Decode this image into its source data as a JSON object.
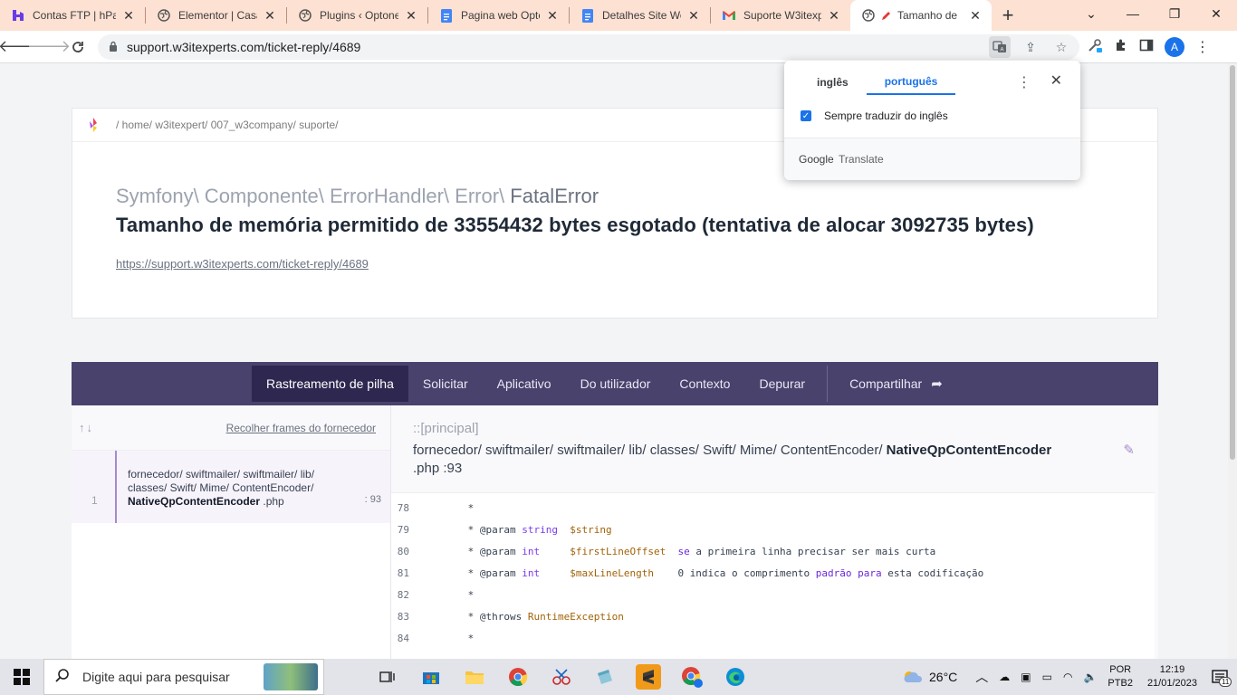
{
  "tabs": [
    {
      "title": "Contas FTP | hPan",
      "icon": "hpanel-icon"
    },
    {
      "title": "Elementor | Casa",
      "icon": "globe-icon"
    },
    {
      "title": "Plugins ‹ Optone",
      "icon": "globe-icon"
    },
    {
      "title": "Pagina web Optc",
      "icon": "docs-icon"
    },
    {
      "title": "Detalhes Site We",
      "icon": "docs-icon"
    },
    {
      "title": "Suporte W3itexp",
      "icon": "gmail-icon"
    },
    {
      "title": "Tamanho de",
      "icon": "globe-icon",
      "active": true
    }
  ],
  "address": {
    "url": "support.w3itexperts.com/ticket-reply/4689"
  },
  "profile": {
    "initial": "A"
  },
  "page": {
    "breadcrumb": "/ home/ w3itexpert/ 007_w3company/ suporte/",
    "error_class_prefix": "Symfony\\ Componente\\ ErrorHandler\\ Error\\ ",
    "error_class_name": "FatalError",
    "error_message": "Tamanho de memória permitido de 33554432 bytes esgotado (tentativa de alocar 3092735 bytes)",
    "error_url": "https://support.w3itexperts.com/ticket-reply/4689"
  },
  "stack_tabs": {
    "trace": "Rastreamento de pilha",
    "request": "Solicitar",
    "app": "Aplicativo",
    "user": "Do utilizador",
    "context": "Contexto",
    "debug": "Depurar",
    "share": "Compartilhar"
  },
  "frames": {
    "arrows": "↑↓",
    "collapse": "Recolher frames do fornecedor",
    "item": {
      "number": "1",
      "path": "fornecedor/ swiftmailer/ swiftmailer/ lib/ classes/ Swift/ Mime/ ContentEncoder/",
      "file": "NativeQpContentEncoder",
      "ext": ".php",
      "line": ": 93"
    }
  },
  "detail": {
    "main_label": "::[principal]",
    "path": "fornecedor/ swiftmailer/ swiftmailer/ lib/ classes/ Swift/ Mime/ ContentEncoder/ ",
    "file": "NativeQpContentEncoder",
    "suffix": ".php :93"
  },
  "code": [
    {
      "n": "78",
      "t": " *"
    },
    {
      "n": "79",
      "t": " * @param string  $string"
    },
    {
      "n": "80",
      "t": " * @param int     $firstLineOffset  se a primeira linha precisar ser mais curta"
    },
    {
      "n": "81",
      "t": " * @param int     $maxLineLength    0 indica o comprimento padrão para esta codificação"
    },
    {
      "n": "82",
      "t": " *"
    },
    {
      "n": "83",
      "t": " * @throws RuntimeException"
    },
    {
      "n": "84",
      "t": " *"
    }
  ],
  "translate": {
    "lang_source": "inglês",
    "lang_target": "português",
    "always_translate": "Sempre traduzir do inglês",
    "brand_google": "Google",
    "brand_translate": "Translate"
  },
  "taskbar": {
    "search_placeholder": "Digite aqui para pesquisar",
    "temperature": "26°C",
    "lang_top": "POR",
    "lang_bottom": "PTB2",
    "time": "12:19",
    "date": "21/01/2023",
    "notifications": "11"
  },
  "colors": {
    "tabstrip": "#fde1d3",
    "stack_bar": "#49426c",
    "stack_active": "#2e2850",
    "accent_blue": "#1a73e8",
    "frame_accent": "#a58bc9"
  }
}
